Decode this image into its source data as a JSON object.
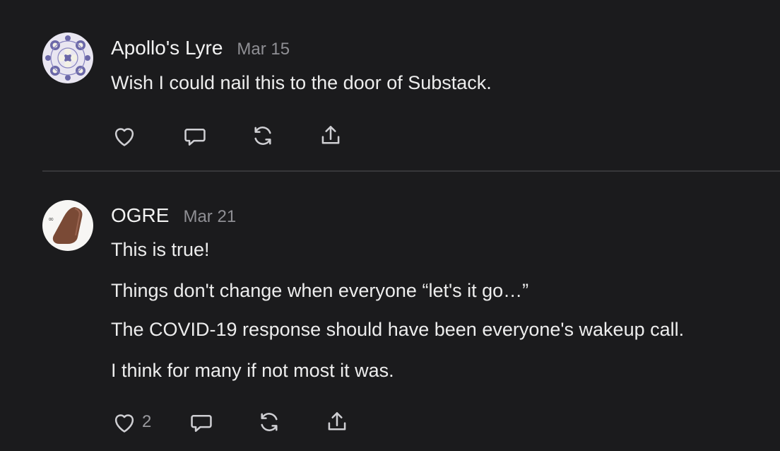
{
  "comments": [
    {
      "author": "Apollo's Lyre",
      "date": "Mar 15",
      "avatar_icon": "mandala-pattern-avatar",
      "paragraphs": [
        "Wish I could nail this to the door of Substack."
      ],
      "actions": {
        "like_icon": "heart-icon",
        "like_count": "",
        "reply_icon": "comment-bubble-icon",
        "restack_icon": "restack-icon",
        "share_icon": "share-icon"
      }
    },
    {
      "author": "OGRE",
      "date": "Mar 21",
      "avatar_icon": "brown-shoe-avatar",
      "paragraphs": [
        "This is true!",
        "Things don't change when everyone “let's it go…”",
        "The COVID-19 response should have been everyone's wakeup call.",
        "I think for many if not most it was."
      ],
      "actions": {
        "like_icon": "heart-icon",
        "like_count": "2",
        "reply_icon": "comment-bubble-icon",
        "restack_icon": "restack-icon",
        "share_icon": "share-icon"
      }
    }
  ],
  "colors": {
    "background": "#1b1b1d",
    "text": "#ededed",
    "muted": "#8f8f94",
    "divider": "#37373a"
  }
}
